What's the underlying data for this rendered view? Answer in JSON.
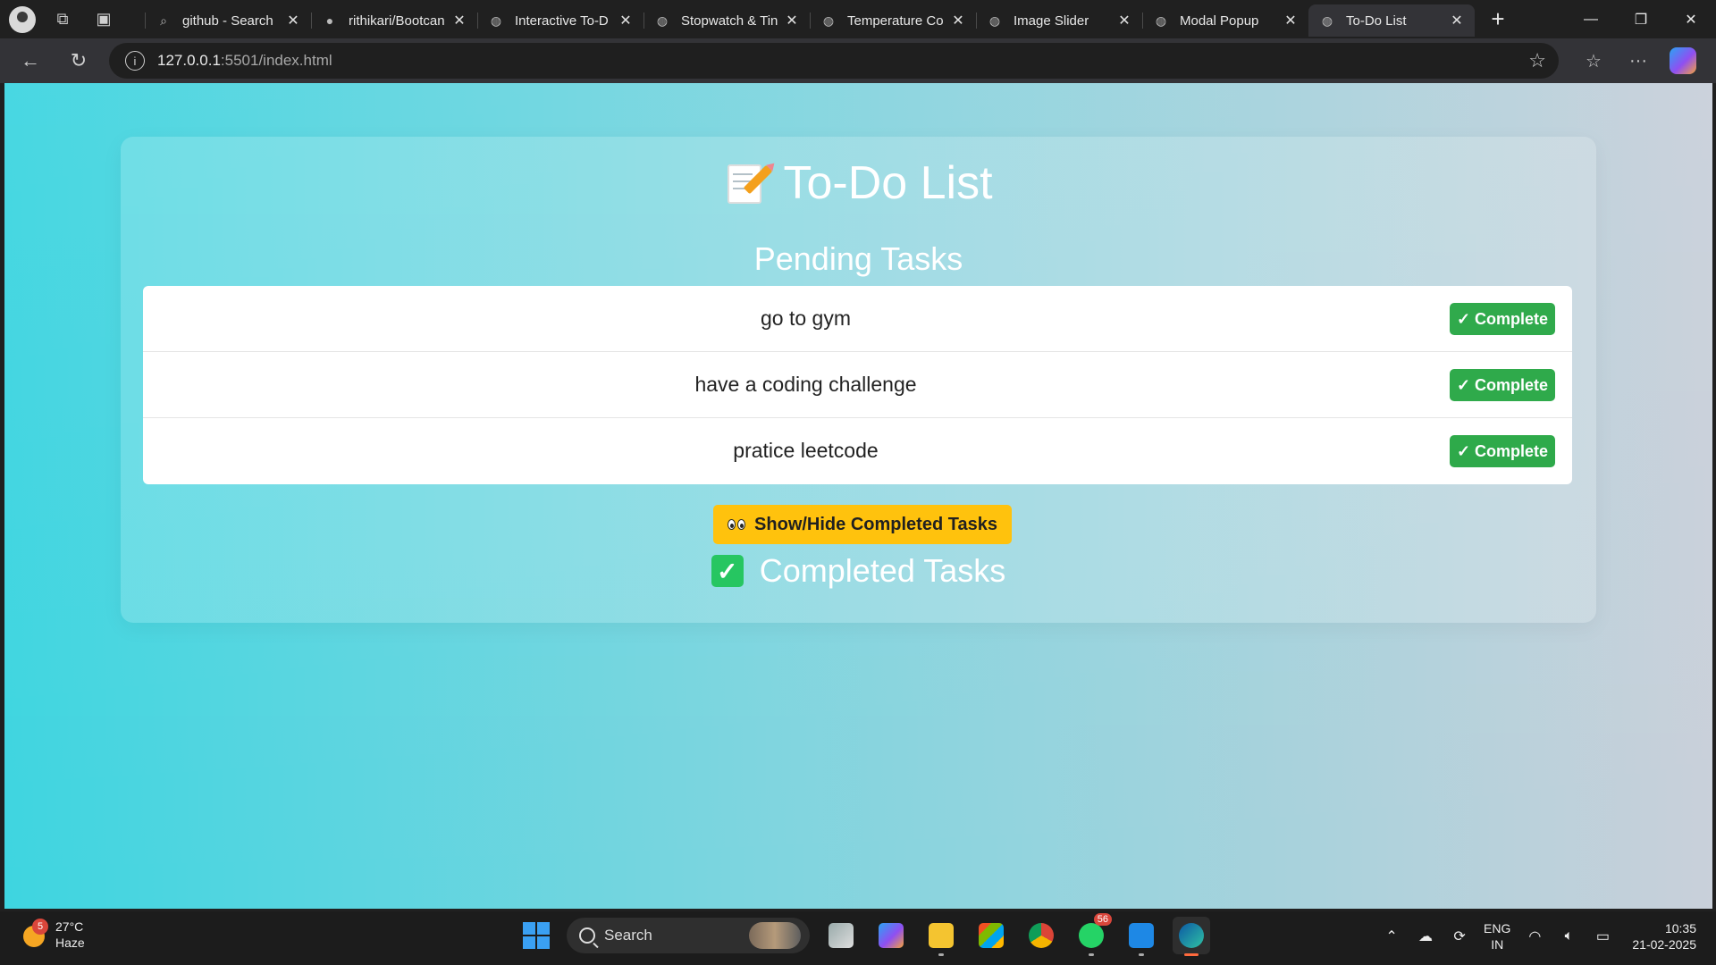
{
  "browser": {
    "tabs": [
      {
        "title": "github - Search",
        "icon": "search-icon",
        "active": false
      },
      {
        "title": "rithikari/Bootcan",
        "icon": "github-icon",
        "active": false
      },
      {
        "title": "Interactive To-D",
        "icon": "globe-icon",
        "active": false
      },
      {
        "title": "Stopwatch & Tin",
        "icon": "globe-icon",
        "active": false
      },
      {
        "title": "Temperature Co",
        "icon": "globe-icon",
        "active": false
      },
      {
        "title": "Image Slider",
        "icon": "globe-icon",
        "active": false
      },
      {
        "title": "Modal Popup",
        "icon": "globe-icon",
        "active": false
      },
      {
        "title": "To-Do List",
        "icon": "globe-icon",
        "active": true
      }
    ],
    "url_host": "127.0.0.1",
    "url_rest": ":5501/index.html"
  },
  "app": {
    "title": "To-Do List",
    "pending_heading": "Pending Tasks",
    "tasks": [
      {
        "text": "go to gym"
      },
      {
        "text": "have a coding challenge"
      },
      {
        "text": "pratice leetcode"
      }
    ],
    "complete_label": "✓ Complete",
    "toggle_label": "Show/Hide Completed Tasks",
    "completed_heading": "Completed Tasks",
    "colors": {
      "complete": "#28a745",
      "toggle": "#ffc107",
      "check": "#22c55e"
    }
  },
  "taskbar": {
    "weather_temp": "27°C",
    "weather_desc": "Haze",
    "weather_badge": "5",
    "search_label": "Search",
    "whatsapp_badge": "56",
    "lang_top": "ENG",
    "lang_bottom": "IN",
    "time": "10:35",
    "date": "21-02-2025"
  }
}
